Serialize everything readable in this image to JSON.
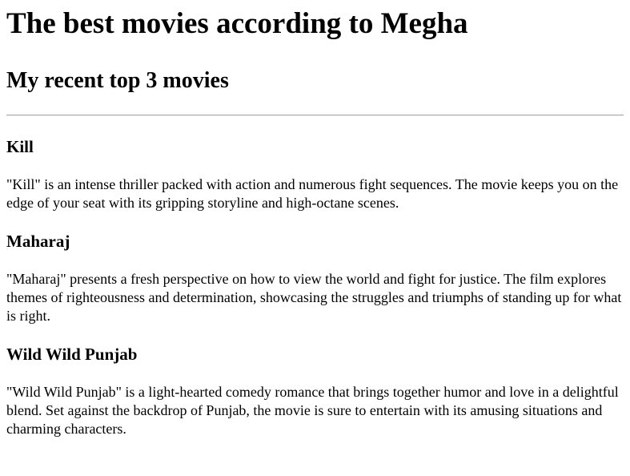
{
  "page": {
    "title": "The best movies according to Megha",
    "subtitle": "My recent top 3 movies"
  },
  "movies": [
    {
      "name": "Kill",
      "description": "\"Kill\" is an intense thriller packed with action and numerous fight sequences. The movie keeps you on the edge of your seat with its gripping storyline and high-octane scenes."
    },
    {
      "name": "Maharaj",
      "description": "\"Maharaj\" presents a fresh perspective on how to view the world and fight for justice. The film explores themes of righteousness and determination, showcasing the struggles and triumphs of standing up for what is right."
    },
    {
      "name": "Wild Wild Punjab",
      "description": "\"Wild Wild Punjab\" is a light-hearted comedy romance that brings together humor and love in a delightful blend. Set against the backdrop of Punjab, the movie is sure to entertain with its amusing situations and charming characters."
    }
  ]
}
